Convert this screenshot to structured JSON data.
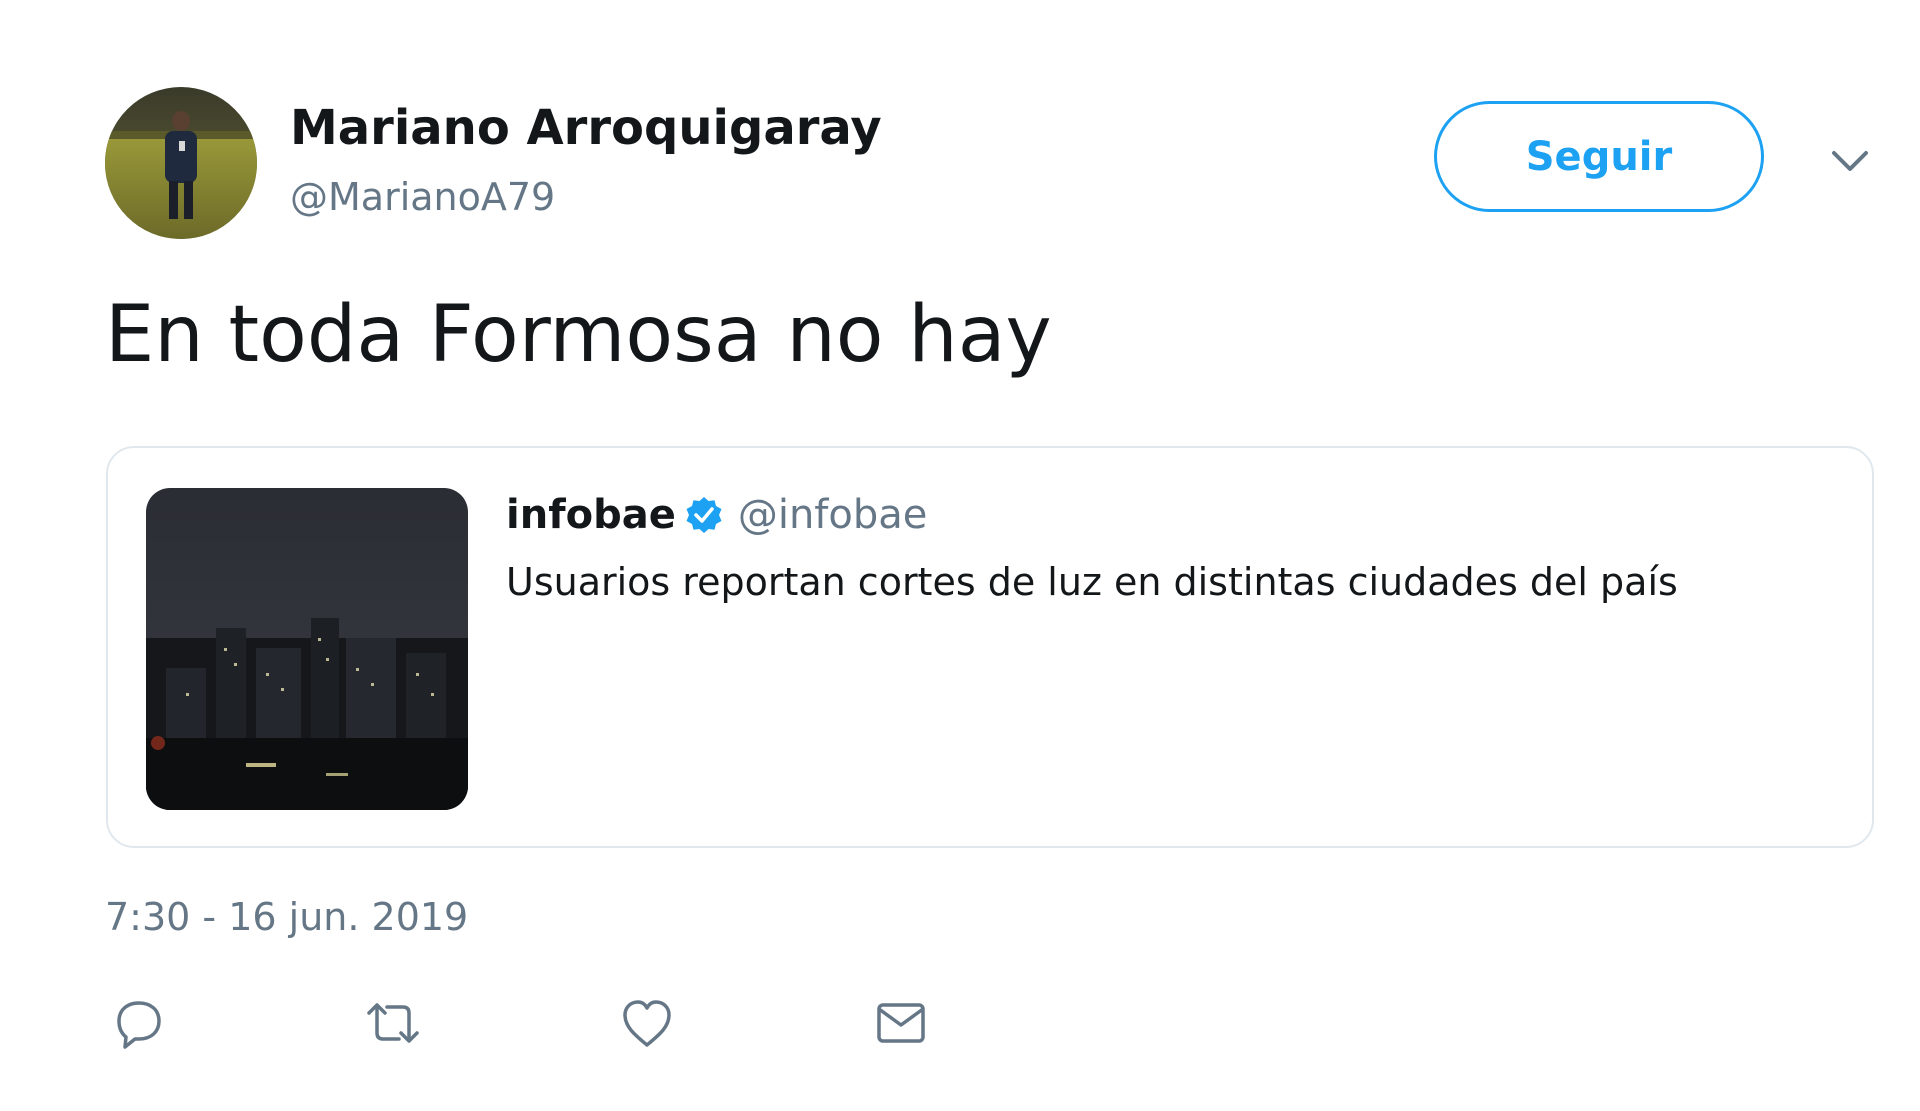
{
  "author": {
    "name": "Mariano Arroquigaray",
    "handle": "@MarianoA79",
    "avatar_icon": "profile-photo"
  },
  "follow_button": {
    "label": "Seguir",
    "color": "#1da1f2"
  },
  "menu": {
    "icon": "chevron-down-icon"
  },
  "tweet": {
    "text": "En toda Formosa no hay",
    "timestamp": "7:30 - 16 jun. 2019"
  },
  "quoted_tweet": {
    "name": "infobae",
    "verified": true,
    "handle": "@infobae",
    "text": "Usuarios reportan cortes de luz en distintas ciudades del país",
    "image_icon": "night-city-photo"
  },
  "actions": [
    {
      "icon": "reply-icon"
    },
    {
      "icon": "retweet-icon"
    },
    {
      "icon": "like-icon"
    },
    {
      "icon": "direct-message-icon"
    }
  ],
  "colors": {
    "primary_text": "#14171a",
    "secondary_text": "#657786",
    "accent": "#1da1f2",
    "border": "#e1e8ed"
  }
}
